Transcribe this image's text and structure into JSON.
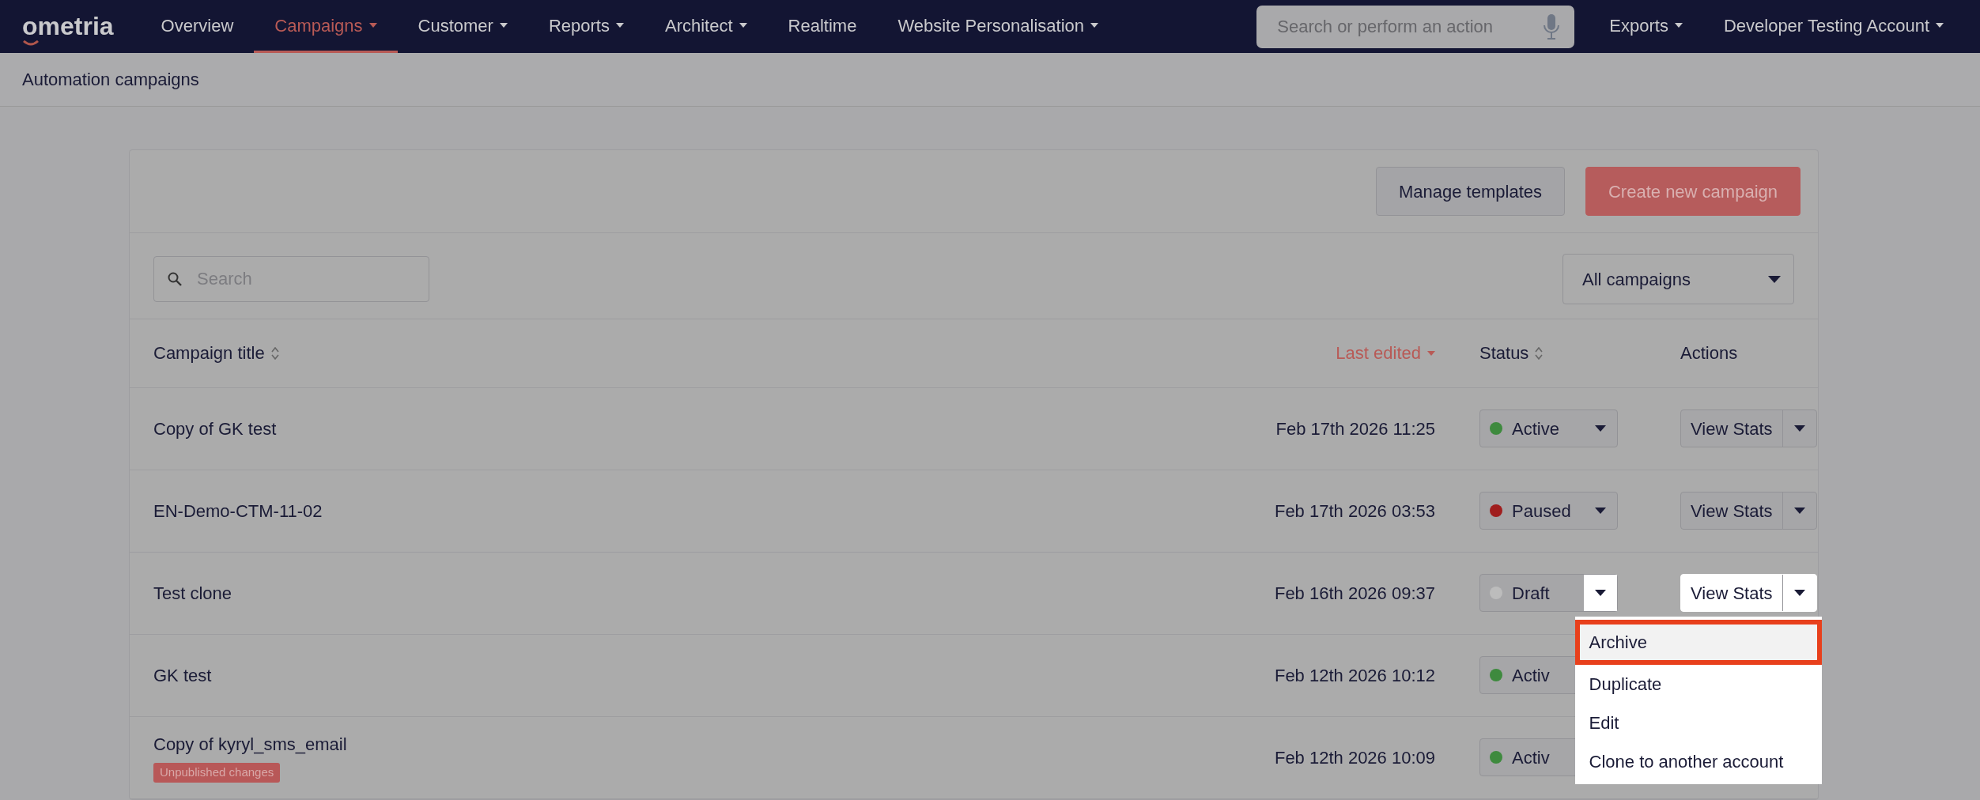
{
  "navbar": {
    "logo": "ometria",
    "items": [
      {
        "label": "Overview",
        "selected": false,
        "caret": false
      },
      {
        "label": "Campaigns",
        "selected": true,
        "caret": true
      },
      {
        "label": "Customer",
        "selected": false,
        "caret": true
      },
      {
        "label": "Reports",
        "selected": false,
        "caret": true
      },
      {
        "label": "Architect",
        "selected": false,
        "caret": true
      },
      {
        "label": "Realtime",
        "selected": false,
        "caret": false
      },
      {
        "label": "Website Personalisation",
        "selected": false,
        "caret": true
      }
    ],
    "search": {
      "placeholder": "Search or perform an action"
    },
    "right_items": [
      {
        "label": "Exports",
        "caret": true
      },
      {
        "label": "Developer Testing Account",
        "caret": true
      }
    ]
  },
  "page_title": "Automation campaigns",
  "toolbar": {
    "buttons": [
      {
        "label": "Manage templates",
        "kind": "secondary"
      },
      {
        "label": "Create new campaign",
        "kind": "primary"
      }
    ]
  },
  "filters": {
    "search": {
      "placeholder": "Search"
    },
    "select": {
      "value": "All campaigns"
    }
  },
  "table": {
    "columns": [
      {
        "label": "Campaign title",
        "sortable": true,
        "active": false
      },
      {
        "label": "Last edited",
        "sortable": true,
        "active": true
      },
      {
        "label": "Status",
        "sortable": true,
        "active": false
      },
      {
        "label": "Actions",
        "sortable": false,
        "active": false
      }
    ],
    "rows": [
      {
        "title": "Copy of GK test",
        "date": "Feb 17th 2026 11:25",
        "status": {
          "label": "Active",
          "color": "#3e8a3e"
        },
        "action": "View Stats",
        "menu_open": false
      },
      {
        "title": "EN-Demo-CTM-11-02",
        "date": "Feb 17th 2026 03:53",
        "status": {
          "label": "Paused",
          "color": "#a01e1e"
        },
        "action": "View Stats",
        "menu_open": false
      },
      {
        "title": "Test clone",
        "date": "Feb 16th 2026 09:37",
        "status": {
          "label": "Draft",
          "color": "#bcbcbc"
        },
        "action": "View Stats",
        "menu_open": true
      },
      {
        "title": "GK test",
        "date": "Feb 12th 2026 10:12",
        "status": {
          "label": "Activ",
          "color": "#3e8a3e"
        },
        "menu_open": false
      },
      {
        "title": "Copy of kyryl_sms_email",
        "badge": "Unpublished changes",
        "date": "Feb 12th 2026 10:09",
        "status": {
          "label": "Activ",
          "color": "#3e8a3e"
        },
        "menu_open": false
      }
    ]
  },
  "action_menu": {
    "items": [
      {
        "label": "Archive",
        "selected": true
      },
      {
        "label": "Duplicate",
        "selected": false
      },
      {
        "label": "Edit",
        "selected": false
      },
      {
        "label": "Clone to another account",
        "selected": false
      }
    ]
  }
}
